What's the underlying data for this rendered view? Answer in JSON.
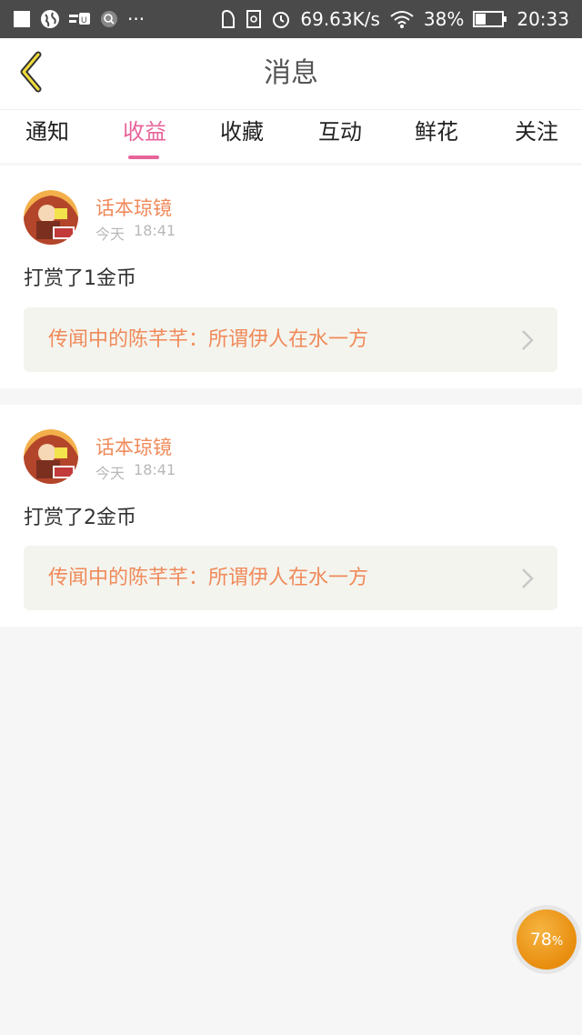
{
  "status_bar": {
    "net_speed": "69.63K/s",
    "battery": "38%",
    "time": "20:33",
    "more": "···"
  },
  "nav": {
    "title": "消息"
  },
  "tabs": [
    {
      "label": "通知"
    },
    {
      "label": "收益"
    },
    {
      "label": "收藏"
    },
    {
      "label": "互动"
    },
    {
      "label": "鲜花"
    },
    {
      "label": "关注"
    }
  ],
  "active_tab": "收益",
  "messages": [
    {
      "author": "话本琼镜",
      "day": "今天",
      "time": "18:41",
      "text": "打赏了1金币",
      "link": "传闻中的陈芊芊：所谓伊人在水一方"
    },
    {
      "author": "话本琼镜",
      "day": "今天",
      "time": "18:41",
      "text": "打赏了2金币",
      "link": "传闻中的陈芊芊：所谓伊人在水一方"
    }
  ],
  "floating_badge": {
    "value": "78",
    "unit": "%"
  },
  "colors": {
    "accent_pink": "#e8639a",
    "accent_orange": "#f08a5a",
    "status_bar": "#4a4a4a"
  }
}
